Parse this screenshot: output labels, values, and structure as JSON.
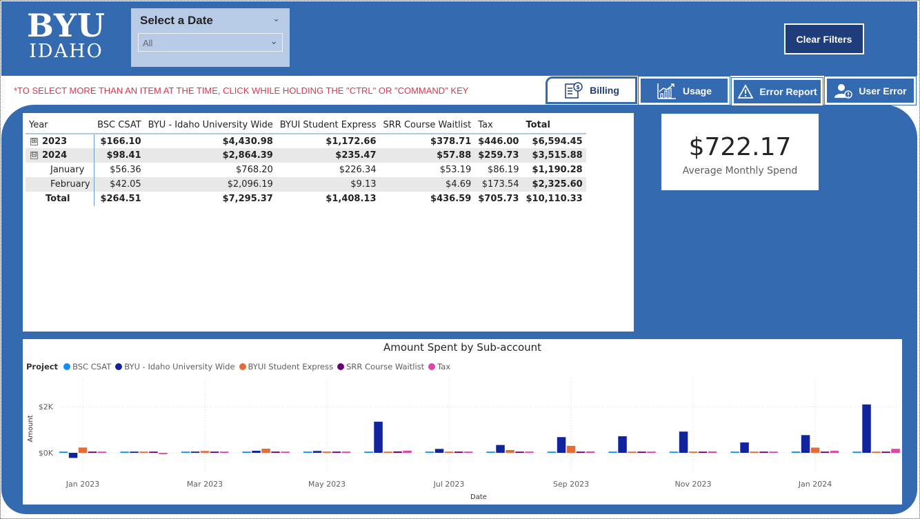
{
  "logo": {
    "line1": "BYU",
    "line2": "IDAHO"
  },
  "date_slicer": {
    "title": "Select a Date",
    "value": "All"
  },
  "clear_filters_label": "Clear Filters",
  "notice": "*TO SELECT MORE THAN AN ITEM AT THE TIME, CLICK WHILE HOLDING THE \"CTRL\" OR \"COMMAND\" KEY",
  "tabs": [
    {
      "label": "Billing",
      "icon": "billing-icon",
      "active": true
    },
    {
      "label": "Usage",
      "icon": "usage-chart-icon",
      "active": false
    },
    {
      "label": "Error Report",
      "icon": "warning-icon",
      "active": false
    },
    {
      "label": "User Error",
      "icon": "user-error-icon",
      "active": false
    }
  ],
  "matrix": {
    "headers": [
      "Year",
      "BSC CSAT",
      "BYU - Idaho University Wide",
      "BYUI Student Express",
      "SRR Course Waitlist",
      "Tax",
      "Total"
    ],
    "rows": [
      {
        "label": "2023",
        "expand": "⊞",
        "values": [
          "$166.10",
          "$4,430.98",
          "$1,172.66",
          "$378.71",
          "$446.00",
          "$6,594.45"
        ]
      },
      {
        "label": "2024",
        "expand": "⊟",
        "values": [
          "$98.41",
          "$2,864.39",
          "$235.47",
          "$57.88",
          "$259.73",
          "$3,515.88"
        ]
      },
      {
        "label": "January",
        "values": [
          "$56.36",
          "$768.20",
          "$226.34",
          "$53.19",
          "$86.19",
          "$1,190.28"
        ]
      },
      {
        "label": "February",
        "values": [
          "$42.05",
          "$2,096.19",
          "$9.13",
          "$4.69",
          "$173.54",
          "$2,325.60"
        ]
      },
      {
        "label": "Total",
        "values": [
          "$264.51",
          "$7,295.37",
          "$1,408.13",
          "$436.59",
          "$705.73",
          "$10,110.33"
        ]
      }
    ]
  },
  "kpi": {
    "value": "$722.17",
    "label": "Average Monthly Spend"
  },
  "chart_data": {
    "type": "bar",
    "title": "Amount Spent by Sub-account",
    "legend_title": "Project",
    "xlabel": "Date",
    "ylabel": "Amount",
    "y_ticks": [
      "$2K",
      "$0K"
    ],
    "y_tick_values": [
      2000,
      0
    ],
    "x_ticks": [
      "Jan 2023",
      "Mar 2023",
      "May 2023",
      "Jul 2023",
      "Sep 2023",
      "Nov 2023",
      "Jan 2024"
    ],
    "x_tick_month_index": [
      0,
      2,
      4,
      6,
      8,
      10,
      12
    ],
    "ylim": [
      -300,
      2300
    ],
    "categories": [
      "Jan 2023",
      "Feb 2023",
      "Mar 2023",
      "Apr 2023",
      "May 2023",
      "Jun 2023",
      "Jul 2023",
      "Aug 2023",
      "Sep 2023",
      "Oct 2023",
      "Nov 2023",
      "Dec 2023",
      "Jan 2024",
      "Feb 2024"
    ],
    "series": [
      {
        "name": "BSC CSAT",
        "color": "#118dff",
        "values": [
          10,
          8,
          12,
          10,
          12,
          14,
          15,
          16,
          15,
          14,
          15,
          14,
          56,
          42
        ]
      },
      {
        "name": "BYU - Idaho University Wide",
        "color": "#12239e",
        "values": [
          -220,
          20,
          50,
          90,
          80,
          1350,
          170,
          340,
          680,
          720,
          920,
          450,
          768,
          2096
        ]
      },
      {
        "name": "BYUI Student Express",
        "color": "#e66c37",
        "values": [
          230,
          25,
          80,
          180,
          20,
          20,
          25,
          120,
          300,
          25,
          25,
          20,
          226,
          9
        ]
      },
      {
        "name": "SRR Course Waitlist",
        "color": "#6b007b",
        "values": [
          15,
          15,
          20,
          30,
          20,
          60,
          30,
          30,
          40,
          30,
          50,
          30,
          53,
          5
        ]
      },
      {
        "name": "Tax",
        "color": "#e044a7",
        "values": [
          30,
          -20,
          20,
          25,
          15,
          90,
          20,
          40,
          60,
          50,
          60,
          30,
          86,
          174
        ]
      }
    ]
  }
}
